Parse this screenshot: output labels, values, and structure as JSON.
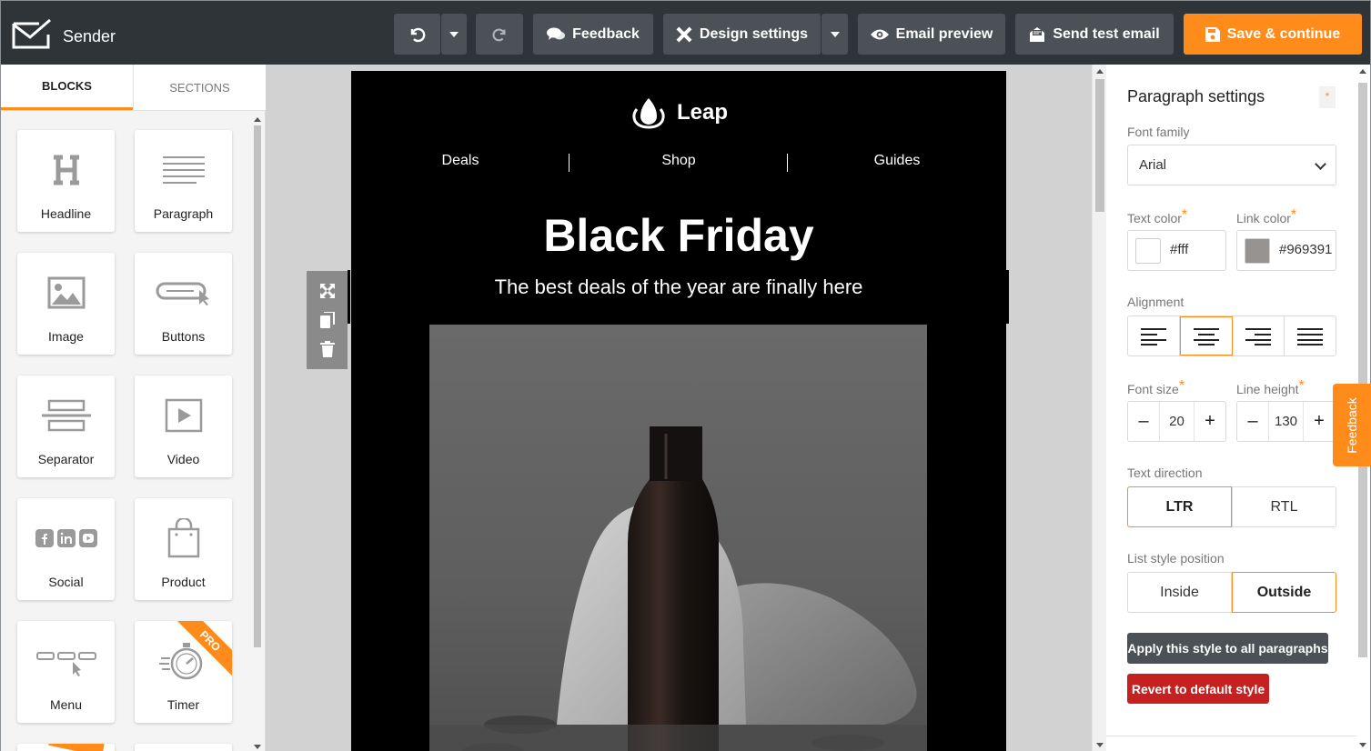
{
  "app": {
    "name": "Sender"
  },
  "toolbar": {
    "feedback_label": "Feedback",
    "design_settings_label": "Design settings",
    "email_preview_label": "Email preview",
    "send_test_label": "Send test email",
    "save_label": "Save & continue"
  },
  "left_panel": {
    "tabs": [
      {
        "label": "BLOCKS",
        "active": true
      },
      {
        "label": "SECTIONS",
        "active": false
      }
    ],
    "blocks": [
      {
        "label": "Headline",
        "icon": "headline-icon"
      },
      {
        "label": "Paragraph",
        "icon": "paragraph-icon"
      },
      {
        "label": "Image",
        "icon": "image-icon"
      },
      {
        "label": "Buttons",
        "icon": "buttons-icon"
      },
      {
        "label": "Separator",
        "icon": "separator-icon"
      },
      {
        "label": "Video",
        "icon": "video-icon"
      },
      {
        "label": "Social",
        "icon": "social-icon"
      },
      {
        "label": "Product",
        "icon": "shopping-bag-icon"
      },
      {
        "label": "Menu",
        "icon": "menu-icon"
      },
      {
        "label": "Timer",
        "icon": "stopwatch-icon",
        "badge": "PRO"
      }
    ]
  },
  "email": {
    "brand": "Leap",
    "nav": [
      "Deals",
      "Shop",
      "Guides"
    ],
    "title": "Black Friday",
    "subtitle": "The best deals of the year are finally here"
  },
  "settings": {
    "title": "Paragraph settings",
    "star": "*",
    "font_family_label": "Font family",
    "font_family_value": "Arial",
    "text_color_label": "Text color",
    "text_color_value": "#fff",
    "link_color_label": "Link color",
    "link_color_value": "#969391",
    "alignment_label": "Alignment",
    "alignment_selected": "center",
    "font_size_label": "Font size",
    "font_size_value": "20",
    "line_height_label": "Line height",
    "line_height_value": "130",
    "text_direction_label": "Text direction",
    "text_direction_options": [
      "LTR",
      "RTL"
    ],
    "text_direction_selected": "LTR",
    "list_style_label": "List style position",
    "list_style_options": [
      "Inside",
      "Outside"
    ],
    "list_style_selected": "Outside",
    "apply_label": "Apply this style to all paragraphs",
    "revert_label": "Revert to default style"
  },
  "feedback_tab": "Feedback",
  "colors": {
    "accent": "#ff8c1a",
    "topbar": "#2f3438",
    "button_dark": "#4b5156",
    "danger": "#c62121"
  }
}
